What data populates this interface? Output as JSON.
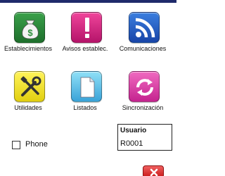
{
  "menu": {
    "establecimientos": {
      "label": "Establecimientos",
      "icon": "money-bag-icon",
      "color": "#2f8f3e"
    },
    "avisos": {
      "label": "Avisos establec.",
      "icon": "exclamation-icon",
      "color": "#d92a83"
    },
    "comunicaciones": {
      "label": "Comunicaciones",
      "icon": "rss-icon",
      "color": "#2a63c8"
    },
    "utilidades": {
      "label": "Utilidades",
      "icon": "tools-icon",
      "color": "#f2e22e"
    },
    "listados": {
      "label": "Listados",
      "icon": "document-icon",
      "color": "#5bbde6"
    },
    "sincronizacion": {
      "label": "Sincronización",
      "icon": "sync-icon",
      "color": "#e04aab"
    }
  },
  "phone": {
    "label": "Phone",
    "checked": false
  },
  "user": {
    "title": "Usuario",
    "value": "R0001"
  },
  "close": {
    "icon": "close-icon",
    "color": "#d42020"
  }
}
